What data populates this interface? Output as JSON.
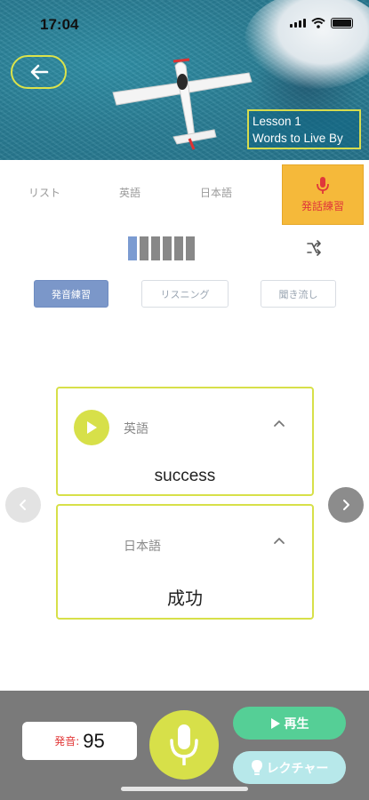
{
  "status_bar": {
    "time": "17:04"
  },
  "header": {
    "lesson_number": "Lesson 1",
    "lesson_title": "Words to Live By"
  },
  "tabs": [
    {
      "label": "リスト"
    },
    {
      "label": "英語"
    },
    {
      "label": "日本語"
    },
    {
      "label": "発話練習",
      "active": true
    }
  ],
  "progress": {
    "current": 1,
    "total": 6
  },
  "modes": [
    {
      "label": "発音練習",
      "active": true
    },
    {
      "label": "リスニング",
      "active": false
    },
    {
      "label": "聞き流し",
      "active": false
    }
  ],
  "card_english": {
    "label": "英語",
    "word": "success"
  },
  "card_japanese": {
    "label": "日本語",
    "word": "成功"
  },
  "bottom_bar": {
    "score_label": "発音:",
    "score_value": "95",
    "play_label": "再生",
    "lecture_label": "レクチャー"
  },
  "colors": {
    "accent_yellow_green": "#d7e049",
    "speak_tab_bg": "#f5b93a",
    "speak_tab_text": "#e0383a",
    "play_button": "#55cf96",
    "lecture_button": "#b7e8ea",
    "active_mode": "#7b97c9",
    "bottom_bar": "#7a7a7a"
  },
  "icons": [
    "back-arrow-icon",
    "airplane-icon",
    "microphone-icon",
    "shuffle-icon",
    "play-icon",
    "chevron-up-icon",
    "chevron-left-icon",
    "chevron-right-icon",
    "lightbulb-icon",
    "wifi-icon",
    "battery-icon",
    "signal-icon"
  ]
}
